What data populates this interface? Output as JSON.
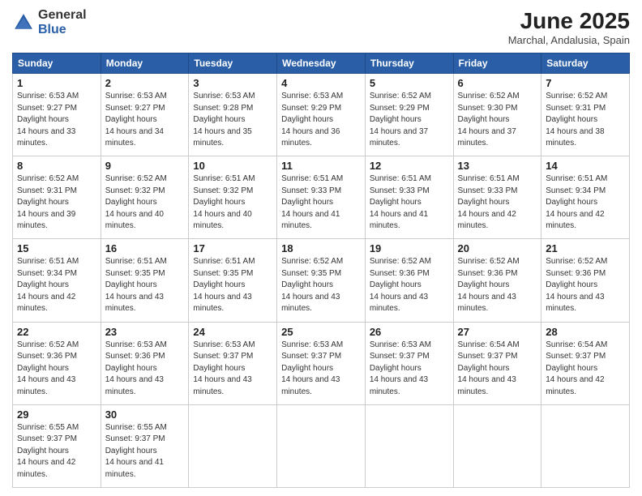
{
  "header": {
    "logo_general": "General",
    "logo_blue": "Blue",
    "month_title": "June 2025",
    "location": "Marchal, Andalusia, Spain"
  },
  "weekdays": [
    "Sunday",
    "Monday",
    "Tuesday",
    "Wednesday",
    "Thursday",
    "Friday",
    "Saturday"
  ],
  "weeks": [
    [
      {
        "day": "1",
        "sunrise": "6:53 AM",
        "sunset": "9:27 PM",
        "daylight": "14 hours and 33 minutes."
      },
      {
        "day": "2",
        "sunrise": "6:53 AM",
        "sunset": "9:27 PM",
        "daylight": "14 hours and 34 minutes."
      },
      {
        "day": "3",
        "sunrise": "6:53 AM",
        "sunset": "9:28 PM",
        "daylight": "14 hours and 35 minutes."
      },
      {
        "day": "4",
        "sunrise": "6:53 AM",
        "sunset": "9:29 PM",
        "daylight": "14 hours and 36 minutes."
      },
      {
        "day": "5",
        "sunrise": "6:52 AM",
        "sunset": "9:29 PM",
        "daylight": "14 hours and 37 minutes."
      },
      {
        "day": "6",
        "sunrise": "6:52 AM",
        "sunset": "9:30 PM",
        "daylight": "14 hours and 37 minutes."
      },
      {
        "day": "7",
        "sunrise": "6:52 AM",
        "sunset": "9:31 PM",
        "daylight": "14 hours and 38 minutes."
      }
    ],
    [
      {
        "day": "8",
        "sunrise": "6:52 AM",
        "sunset": "9:31 PM",
        "daylight": "14 hours and 39 minutes."
      },
      {
        "day": "9",
        "sunrise": "6:52 AM",
        "sunset": "9:32 PM",
        "daylight": "14 hours and 40 minutes."
      },
      {
        "day": "10",
        "sunrise": "6:51 AM",
        "sunset": "9:32 PM",
        "daylight": "14 hours and 40 minutes."
      },
      {
        "day": "11",
        "sunrise": "6:51 AM",
        "sunset": "9:33 PM",
        "daylight": "14 hours and 41 minutes."
      },
      {
        "day": "12",
        "sunrise": "6:51 AM",
        "sunset": "9:33 PM",
        "daylight": "14 hours and 41 minutes."
      },
      {
        "day": "13",
        "sunrise": "6:51 AM",
        "sunset": "9:33 PM",
        "daylight": "14 hours and 42 minutes."
      },
      {
        "day": "14",
        "sunrise": "6:51 AM",
        "sunset": "9:34 PM",
        "daylight": "14 hours and 42 minutes."
      }
    ],
    [
      {
        "day": "15",
        "sunrise": "6:51 AM",
        "sunset": "9:34 PM",
        "daylight": "14 hours and 42 minutes."
      },
      {
        "day": "16",
        "sunrise": "6:51 AM",
        "sunset": "9:35 PM",
        "daylight": "14 hours and 43 minutes."
      },
      {
        "day": "17",
        "sunrise": "6:51 AM",
        "sunset": "9:35 PM",
        "daylight": "14 hours and 43 minutes."
      },
      {
        "day": "18",
        "sunrise": "6:52 AM",
        "sunset": "9:35 PM",
        "daylight": "14 hours and 43 minutes."
      },
      {
        "day": "19",
        "sunrise": "6:52 AM",
        "sunset": "9:36 PM",
        "daylight": "14 hours and 43 minutes."
      },
      {
        "day": "20",
        "sunrise": "6:52 AM",
        "sunset": "9:36 PM",
        "daylight": "14 hours and 43 minutes."
      },
      {
        "day": "21",
        "sunrise": "6:52 AM",
        "sunset": "9:36 PM",
        "daylight": "14 hours and 43 minutes."
      }
    ],
    [
      {
        "day": "22",
        "sunrise": "6:52 AM",
        "sunset": "9:36 PM",
        "daylight": "14 hours and 43 minutes."
      },
      {
        "day": "23",
        "sunrise": "6:53 AM",
        "sunset": "9:36 PM",
        "daylight": "14 hours and 43 minutes."
      },
      {
        "day": "24",
        "sunrise": "6:53 AM",
        "sunset": "9:37 PM",
        "daylight": "14 hours and 43 minutes."
      },
      {
        "day": "25",
        "sunrise": "6:53 AM",
        "sunset": "9:37 PM",
        "daylight": "14 hours and 43 minutes."
      },
      {
        "day": "26",
        "sunrise": "6:53 AM",
        "sunset": "9:37 PM",
        "daylight": "14 hours and 43 minutes."
      },
      {
        "day": "27",
        "sunrise": "6:54 AM",
        "sunset": "9:37 PM",
        "daylight": "14 hours and 43 minutes."
      },
      {
        "day": "28",
        "sunrise": "6:54 AM",
        "sunset": "9:37 PM",
        "daylight": "14 hours and 42 minutes."
      }
    ],
    [
      {
        "day": "29",
        "sunrise": "6:55 AM",
        "sunset": "9:37 PM",
        "daylight": "14 hours and 42 minutes."
      },
      {
        "day": "30",
        "sunrise": "6:55 AM",
        "sunset": "9:37 PM",
        "daylight": "14 hours and 41 minutes."
      },
      null,
      null,
      null,
      null,
      null
    ]
  ]
}
